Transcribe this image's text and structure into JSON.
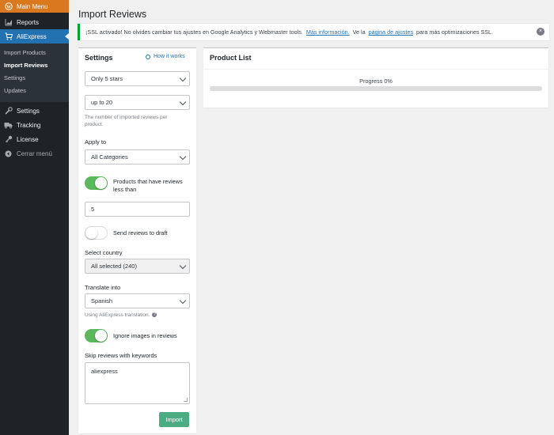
{
  "sidebar": {
    "main_menu": "Main Menu",
    "reports": "Reports",
    "aliexpress": "AliExpress",
    "submenu": [
      "Import Products",
      "Import Reviews",
      "Settings",
      "Updates"
    ],
    "settings": "Settings",
    "tracking": "Tracking",
    "license": "License",
    "collapse": "Cerrar menú",
    "active_submenu": "Import Reviews",
    "colors": {
      "main_menu_bg": "#d9781f",
      "active_bg": "#2271b1",
      "sidebar_bg": "#1d2327"
    }
  },
  "page": {
    "title": "Import Reviews"
  },
  "notice": {
    "text_1": "¡SSL activado!  No olvides cambiar tus ajustes en Google Analytics y Webmaster tools.",
    "link_1": "Más información.",
    "text_2": "Ve la",
    "link_2": "página de ajustes",
    "text_3": "para más optimizaciones SSL."
  },
  "settings": {
    "title": "Settings",
    "how_it_works": "How it works",
    "rating_select": "Only 5 stars",
    "count_select": "up to 20",
    "count_hint": "The number of imported reviews per product.",
    "apply_to_label": "Apply to",
    "apply_to_select": "All Categories",
    "toggle_reviews_less_than": {
      "label": "Products that have reviews less than",
      "on": true
    },
    "reviews_less_than_value": "5",
    "toggle_draft": {
      "label": "Send reviews to draft",
      "on": false
    },
    "country_label": "Select country",
    "country_select": "All selected (240)",
    "translate_label": "Translate into",
    "translate_select": "Spanish",
    "translate_hint": "Using AliExpress translation.",
    "toggle_ignore_images": {
      "label": "Ignore images in reviews",
      "on": true
    },
    "keywords_label": "Skip reviews with keywords",
    "keywords_value": "aliexpress",
    "import_button": "Import",
    "colors": {
      "toggle_on": "#5cb85c",
      "import_button": "#4bab83"
    }
  },
  "product_list": {
    "title": "Product List",
    "progress_text": "Progress 0%",
    "progress_value": 0
  }
}
